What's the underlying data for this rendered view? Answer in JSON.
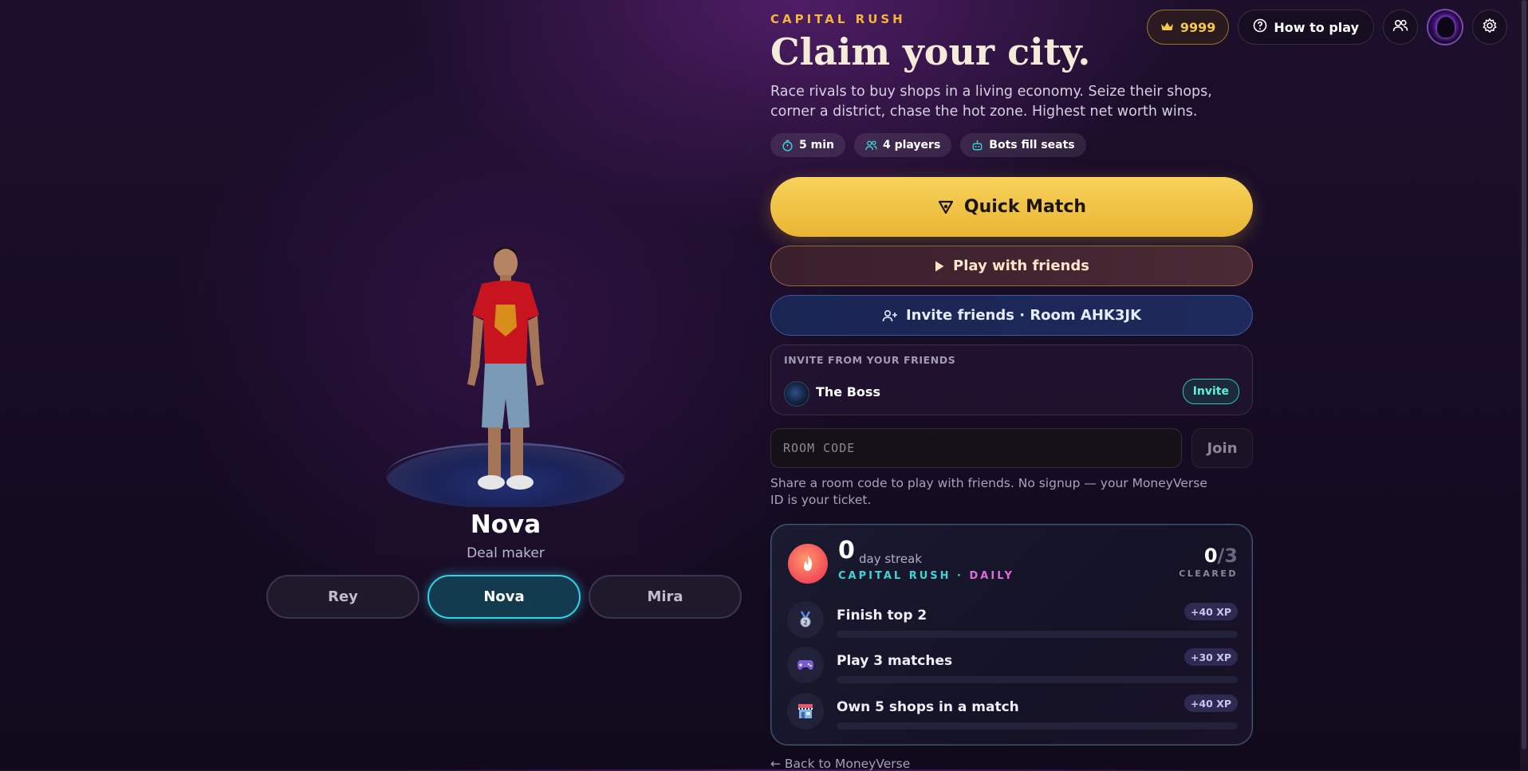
{
  "header": {
    "coins": "9999",
    "how_to_play": "How to play",
    "icons": {
      "coins": "crown-icon",
      "how_to_play": "help-circle-icon",
      "friends": "users-icon",
      "profile": "avatar",
      "settings": "gear-icon"
    }
  },
  "character": {
    "name": "Nova",
    "role": "Deal maker",
    "options": [
      {
        "label": "Rey",
        "selected": false
      },
      {
        "label": "Nova",
        "selected": true
      },
      {
        "label": "Mira",
        "selected": false
      }
    ]
  },
  "hero": {
    "eyebrow": "CAPITAL RUSH",
    "title": "Claim your city.",
    "description": "Race rivals to buy shops in a living economy. Seize their shops, corner a district, chase the hot zone. Highest net worth wins.",
    "chips": [
      {
        "label": "5 min",
        "icon": "timer-icon"
      },
      {
        "label": "4 players",
        "icon": "users-icon"
      },
      {
        "label": "Bots fill seats",
        "icon": "robot-icon"
      }
    ]
  },
  "actions": {
    "quick_match": "Quick Match",
    "play_with_friends": "Play with friends",
    "invite_friends": "Invite friends · Room AHK3JK"
  },
  "friends_invite": {
    "label": "INVITE FROM YOUR FRIENDS",
    "friends": [
      {
        "name": "The Boss",
        "button": "Invite"
      }
    ]
  },
  "room": {
    "placeholder": "ROOM CODE",
    "value": "",
    "join": "Join",
    "help": "Share a room code to play with friends. No signup — your MoneyVerse ID is your ticket."
  },
  "daily": {
    "streak_value": "0",
    "streak_label": "day streak",
    "tag_left": "CAPITAL RUSH",
    "tag_separator": " · ",
    "tag_right": "DAILY",
    "cleared_value": "0",
    "cleared_total": "/3",
    "cleared_label": "CLEARED",
    "quests": [
      {
        "name": "Finish top 2",
        "xp": "+40 XP",
        "icon": "medal-icon",
        "progress": 0
      },
      {
        "name": "Play 3 matches",
        "xp": "+30 XP",
        "icon": "gamepad-icon",
        "progress": 0
      },
      {
        "name": "Own 5 shops in a match",
        "xp": "+40 XP",
        "icon": "shop-icon",
        "progress": 0
      }
    ]
  },
  "footer": {
    "back_link": "← Back to MoneyVerse"
  },
  "colors": {
    "accent_gold": "#f5b53a",
    "accent_cyan": "#2fd2e8",
    "accent_pink": "#e06bdc",
    "background": "#1a0e28"
  }
}
